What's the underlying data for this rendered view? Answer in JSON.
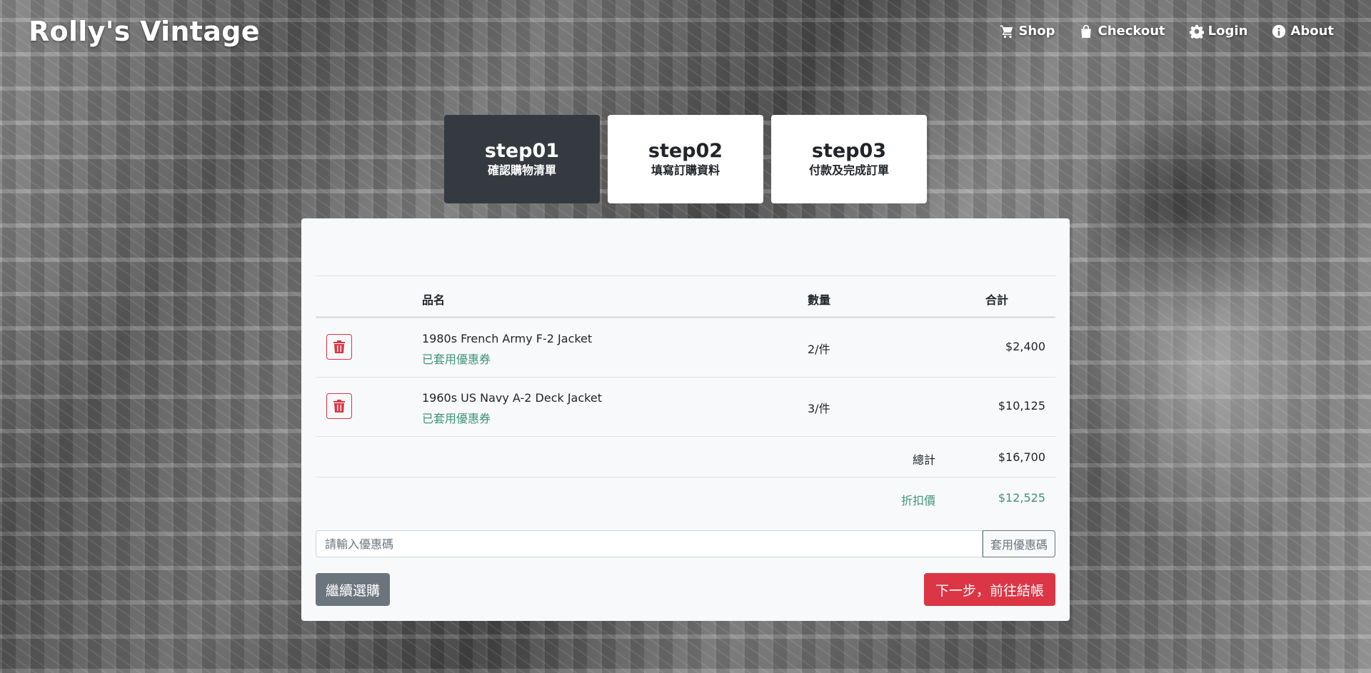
{
  "brand": "Rolly's Vintage",
  "nav": [
    {
      "label": "Shop",
      "icon": "cart-icon"
    },
    {
      "label": "Checkout",
      "icon": "shopping-bag-icon"
    },
    {
      "label": "Login",
      "icon": "gear-icon"
    },
    {
      "label": "About",
      "icon": "info-icon"
    }
  ],
  "steps": [
    {
      "num": "step01",
      "label": "確認購物清單",
      "active": true
    },
    {
      "num": "step02",
      "label": "填寫訂購資料",
      "active": false
    },
    {
      "num": "step03",
      "label": "付款及完成訂單",
      "active": false
    }
  ],
  "table": {
    "headers": {
      "name": "品名",
      "qty": "數量",
      "total": "合計"
    },
    "rows": [
      {
        "name": "1980s French Army F-2 Jacket",
        "coupon": "已套用優惠券",
        "qty": "2/件",
        "total": "$2,400"
      },
      {
        "name": "1960s US Navy A-2 Deck Jacket",
        "coupon": "已套用優惠券",
        "qty": "3/件",
        "total": "$10,125"
      }
    ],
    "summary": {
      "total_label": "總計",
      "total_value": "$16,700",
      "discount_label": "折扣價",
      "discount_value": "$12,525"
    }
  },
  "coupon": {
    "placeholder": "請輸入優惠碼",
    "button": "套用優惠碼"
  },
  "actions": {
    "continue": "繼續選購",
    "next": "下一步，前往結帳"
  },
  "colors": {
    "dark": "#343a40",
    "danger": "#dc3545",
    "secondary": "#6c757d",
    "success_teal": "#3f9476"
  }
}
